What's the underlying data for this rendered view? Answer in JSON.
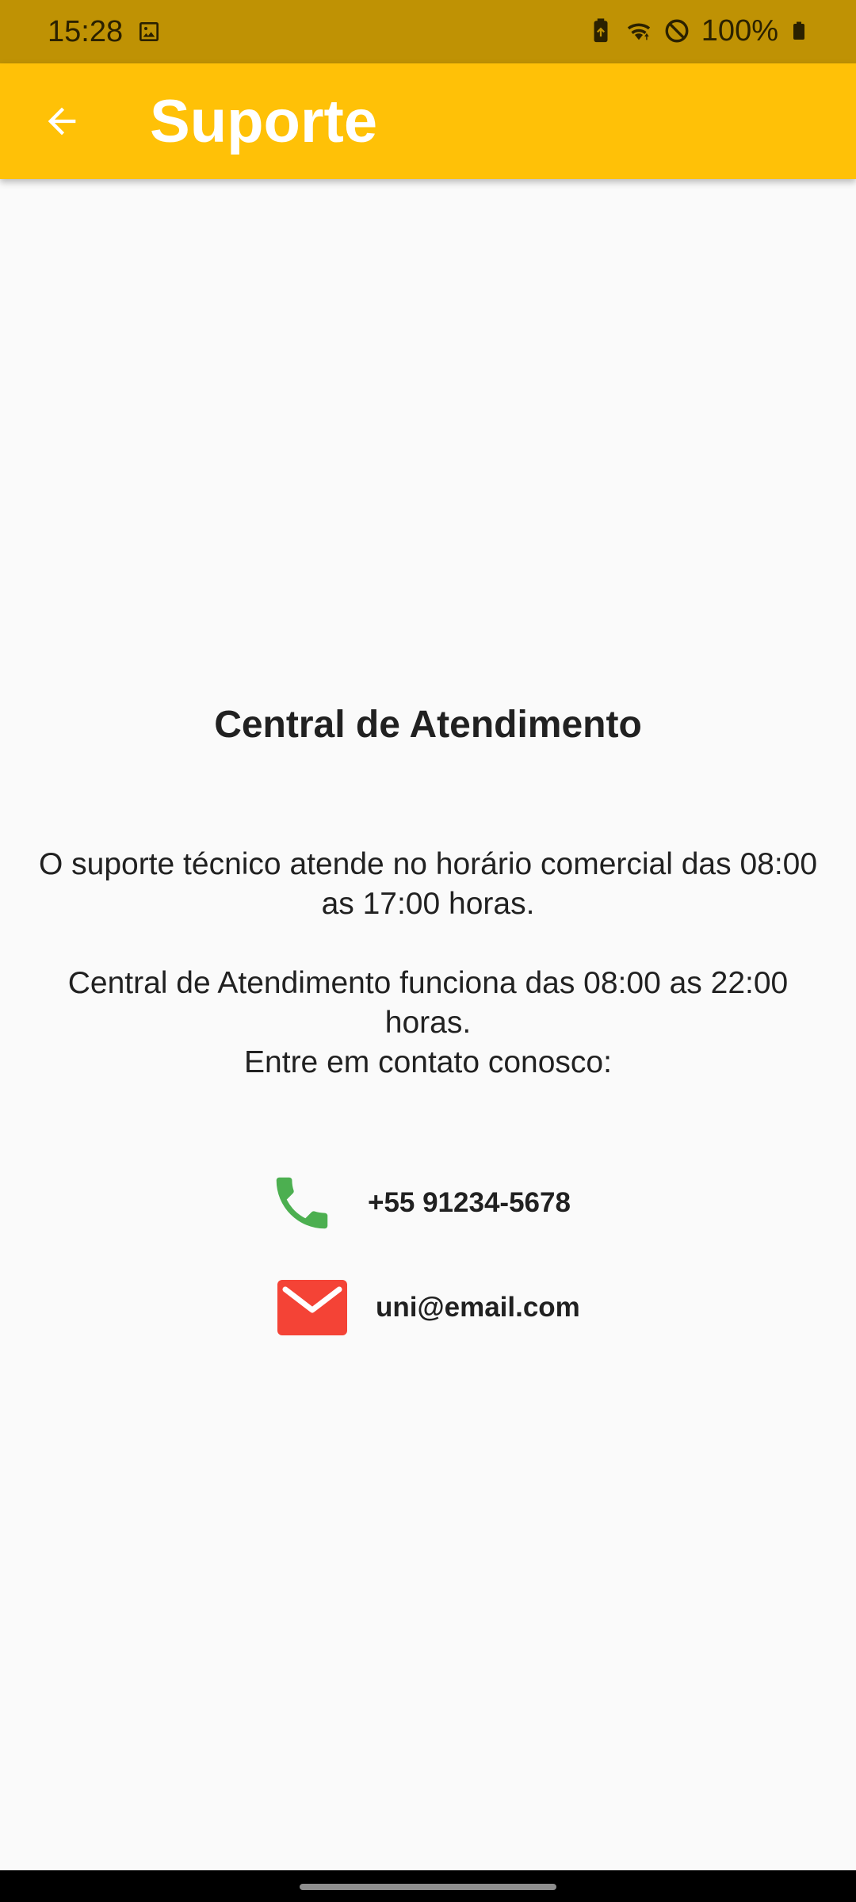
{
  "status_bar": {
    "time": "15:28",
    "battery": "100%",
    "background": "#BF9204",
    "icons": [
      "gallery-icon",
      "battery-saver-icon",
      "wifi-icon",
      "do-not-disturb-icon",
      "battery-icon"
    ]
  },
  "app_bar": {
    "title": "Suporte",
    "background": "#FFC107",
    "back_icon": "arrow-back-icon"
  },
  "content": {
    "title": "Central de Atendimento",
    "paragraph_1": "O suporte técnico atende no horário comercial das 08:00 as 17:00 horas.",
    "paragraph_2": "Central de Atendimento funciona das 08:00 as 22:00 horas.",
    "paragraph_3": "Entre em contato conosco:"
  },
  "contacts": {
    "phone": {
      "value": "+55 91234-5678",
      "icon": "phone-icon",
      "color": "#4CAF50"
    },
    "email": {
      "value": "uni@email.com",
      "icon": "mail-icon",
      "color": "#F44336"
    }
  }
}
